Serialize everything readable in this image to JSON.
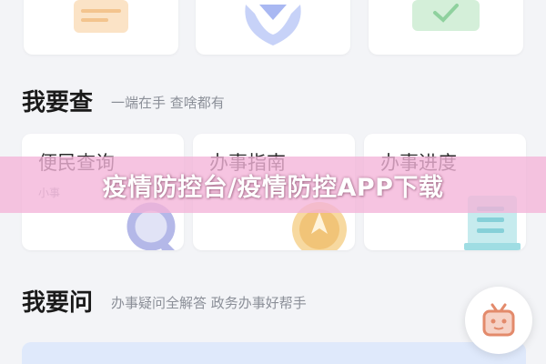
{
  "sections": {
    "query": {
      "title": "我要查",
      "subtitle": "一端在手 查啥都有"
    },
    "ask": {
      "title": "我要问",
      "subtitle": "办事疑问全解答 政务办事好帮手"
    }
  },
  "cards": [
    {
      "title": "便民查询",
      "subtitle": "小事",
      "icon": "magnifier-icon"
    },
    {
      "title": "办事指南",
      "subtitle": "",
      "icon": "compass-icon"
    },
    {
      "title": "办事进度",
      "subtitle": "",
      "icon": "document-list-icon"
    }
  ],
  "top_icons": [
    "clipboard-icon",
    "heart-hands-icon",
    "check-folder-icon"
  ],
  "floating_button": {
    "icon": "tv-robot-icon"
  },
  "banner": {
    "text": "疫情防控台/疫情防控APP下载"
  },
  "colors": {
    "banner": "#f3b4d8",
    "background": "#f3f4f7",
    "accent_blue": "#dfe9fb"
  }
}
